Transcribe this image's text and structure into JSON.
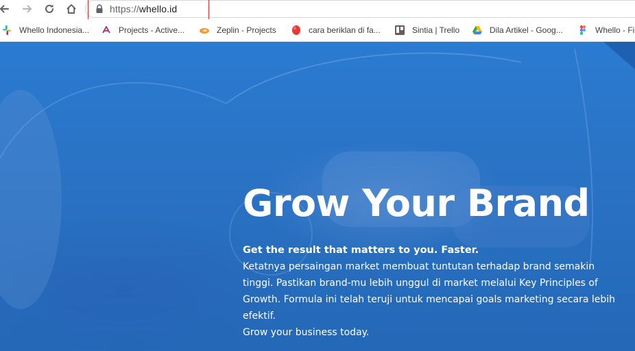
{
  "browser": {
    "url_scheme": "https://",
    "url_host": "whello.id"
  },
  "bookmarks": [
    {
      "label": "Whello Indonesia...",
      "icon": "slack-icon"
    },
    {
      "label": "Projects - Active...",
      "icon": "activecollab-icon"
    },
    {
      "label": "Zeplin - Projects",
      "icon": "zeplin-icon"
    },
    {
      "label": "cara beriklan di fa...",
      "icon": "red-circle-icon"
    },
    {
      "label": "Sintia | Trello",
      "icon": "trello-icon"
    },
    {
      "label": "Dila Artikel - Goog...",
      "icon": "google-drive-icon"
    },
    {
      "label": "Whello - Fi",
      "icon": "figma-icon"
    }
  ],
  "hero": {
    "title": "Grow Your Brand",
    "subtitle": "Get the result that matters to you. Faster.",
    "body_lines": [
      "Ketatnya persaingan market membuat tuntutan terhadap brand semakin",
      "tinggi. Pastikan brand-mu lebih unggul di market melalui Key Principles of",
      "Growth. Formula ini telah teruji untuk mencapai goals marketing secara lebih",
      "efektif.",
      "Grow your business today."
    ]
  },
  "colors": {
    "hero_blue": "#2a7bd2",
    "highlight_red": "#d9342b"
  }
}
